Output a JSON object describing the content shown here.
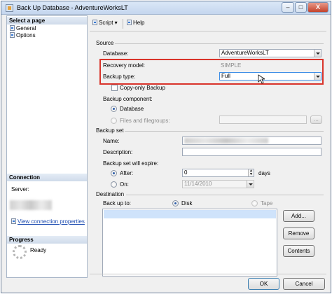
{
  "window": {
    "title": "Back Up Database - AdventureWorksLT",
    "minimize": "–",
    "maximize": "□",
    "close": "X"
  },
  "left": {
    "select_page": "Select a page",
    "pages": [
      {
        "label": "General",
        "icon": "page-icon"
      },
      {
        "label": "Options",
        "icon": "page-icon"
      }
    ],
    "connection": "Connection",
    "server_label": "Server:",
    "view_props": "View connection properties",
    "progress": "Progress",
    "ready": "Ready"
  },
  "toolbar": {
    "script": "Script",
    "help": "Help"
  },
  "source": {
    "title": "Source",
    "database_label": "Database:",
    "database_value": "AdventureWorksLT",
    "recovery_label": "Recovery model:",
    "recovery_value": "SIMPLE",
    "backup_type_label": "Backup type:",
    "backup_type_value": "Full",
    "copy_only": "Copy-only Backup",
    "component_label": "Backup component:",
    "component_database": "Database",
    "component_files": "Files and filegroups:",
    "browse": "..."
  },
  "backup_set": {
    "title": "Backup set",
    "name_label": "Name:",
    "description_label": "Description:",
    "expire_label": "Backup set will expire:",
    "after_label": "After:",
    "after_value": "0",
    "days_label": "days",
    "on_label": "On:",
    "on_value": "11/14/2010"
  },
  "destination": {
    "title": "Destination",
    "backup_to": "Back up to:",
    "disk": "Disk",
    "tape": "Tape",
    "add": "Add...",
    "remove": "Remove",
    "contents": "Contents"
  },
  "footer": {
    "ok": "OK",
    "cancel": "Cancel"
  },
  "colors": {
    "highlight": "#d9342b",
    "selection": "#3d8ee6",
    "link": "#1a4ab0"
  }
}
